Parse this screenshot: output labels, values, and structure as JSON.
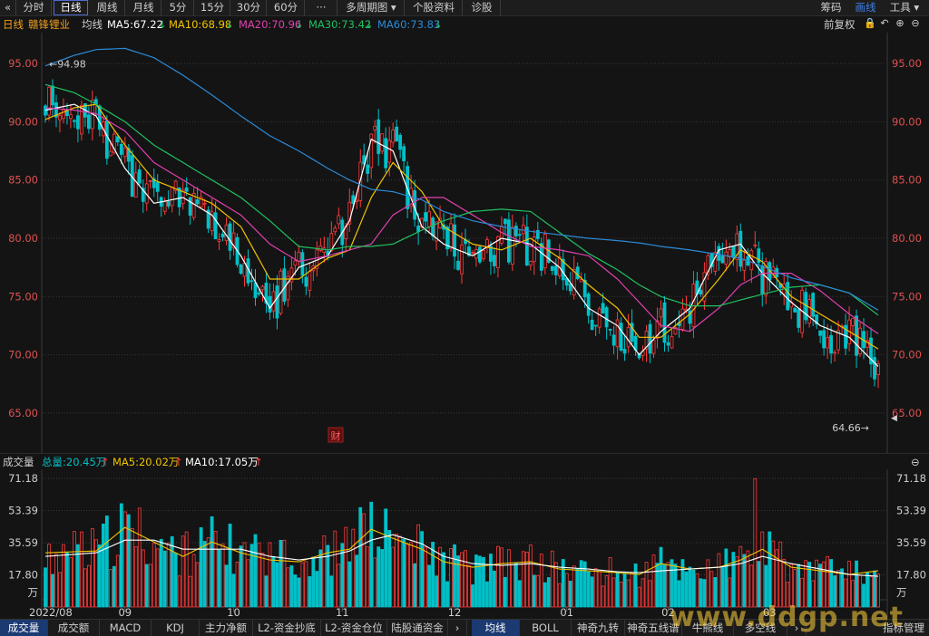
{
  "toolbar": {
    "back": "«",
    "tabs": [
      "分时",
      "日线",
      "周线",
      "月线",
      "5分",
      "15分",
      "30分",
      "60分",
      "···",
      "多周期图 ▾",
      "个股资料",
      "诊股"
    ],
    "active_tab": "日线",
    "right": [
      "筹码",
      "画线",
      "工具 ▾"
    ],
    "right_active": "画线"
  },
  "ma_bar": {
    "period": "日线",
    "stock": "赣锋锂业",
    "avg_label": "均线",
    "ma5": "MA5:67.22",
    "ma10": "MA10:68.98",
    "ma20": "MA20:70.96",
    "ma30": "MA30:73.42",
    "ma60": "MA60:73.83",
    "down_arrow": "↓",
    "fq": "前复权",
    "icons": {
      "lock": "🔒",
      "reset": "↶",
      "zoom_in": "⊕",
      "zoom_out": "⊖"
    }
  },
  "vol_bar": {
    "label": "成交量",
    "total": "总量:20.45万",
    "ma5": "MA5:20.02万",
    "ma10": "MA10:17.05万",
    "up_arrow": "↑",
    "zoom_out": "⊖"
  },
  "colors": {
    "up": "#ff3a3a",
    "down": "#00c0c8",
    "ma5": "#ffffff",
    "ma10": "#f0c400",
    "ma20": "#e040b0",
    "ma30": "#20c060",
    "ma60": "#2a8ad8",
    "axis": "#e05050",
    "grid": "#3a3a3a"
  },
  "chart_data": [
    {
      "type": "candlestick",
      "title": "赣锋锂业 日线",
      "y_ticks": [
        "95.00",
        "90.00",
        "85.00",
        "80.00",
        "75.00",
        "70.00",
        "65.00"
      ],
      "ylim": [
        62.5,
        97.5
      ],
      "x_ticks": [
        "2022/08",
        "09",
        "10",
        "11",
        "12",
        "01",
        "02",
        "03"
      ],
      "annotations": {
        "max_label": "94.98",
        "min_label": "64.66",
        "event_tag": "财"
      },
      "series": [
        {
          "name": "MA5",
          "color": "#ffffff",
          "values": [
            [
              0,
              91.0
            ],
            [
              8,
              91.5
            ],
            [
              14,
              90.5
            ],
            [
              22,
              86
            ],
            [
              30,
              83
            ],
            [
              38,
              83.5
            ],
            [
              46,
              82
            ],
            [
              54,
              78.5
            ],
            [
              62,
              74
            ],
            [
              70,
              77.5
            ],
            [
              78,
              78.5
            ],
            [
              84,
              81.5
            ],
            [
              90,
              88.5
            ],
            [
              96,
              87.5
            ],
            [
              104,
              81
            ],
            [
              110,
              79.5
            ],
            [
              118,
              78.5
            ],
            [
              126,
              80
            ],
            [
              134,
              79.5
            ],
            [
              142,
              77.5
            ],
            [
              150,
              74
            ],
            [
              158,
              72.5
            ],
            [
              164,
              70
            ],
            [
              170,
              72
            ],
            [
              178,
              74
            ],
            [
              186,
              79
            ],
            [
              192,
              79.5
            ],
            [
              198,
              77
            ],
            [
              206,
              74.5
            ],
            [
              214,
              72.5
            ],
            [
              222,
              71.5
            ],
            [
              230,
              69
            ]
          ]
        },
        {
          "name": "MA10",
          "color": "#f0c400",
          "values": [
            [
              0,
              90.2
            ],
            [
              8,
              91.2
            ],
            [
              14,
              91.5
            ],
            [
              22,
              88
            ],
            [
              30,
              85
            ],
            [
              38,
              84
            ],
            [
              46,
              83
            ],
            [
              54,
              81
            ],
            [
              62,
              76.5
            ],
            [
              70,
              76.5
            ],
            [
              78,
              78.3
            ],
            [
              84,
              79
            ],
            [
              90,
              83.5
            ],
            [
              96,
              86.5
            ],
            [
              104,
              84
            ],
            [
              110,
              81
            ],
            [
              118,
              79.5
            ],
            [
              126,
              79
            ],
            [
              134,
              80
            ],
            [
              142,
              78.3
            ],
            [
              150,
              76
            ],
            [
              158,
              74
            ],
            [
              164,
              71.5
            ],
            [
              170,
              71.5
            ],
            [
              178,
              73.5
            ],
            [
              186,
              76.5
            ],
            [
              192,
              79
            ],
            [
              198,
              78
            ],
            [
              206,
              75
            ],
            [
              214,
              73.5
            ],
            [
              222,
              72
            ],
            [
              230,
              70.5
            ]
          ]
        },
        {
          "name": "MA20",
          "color": "#e040b0",
          "values": [
            [
              0,
              91.2
            ],
            [
              8,
              91
            ],
            [
              14,
              90.7
            ],
            [
              22,
              89.2
            ],
            [
              30,
              86.5
            ],
            [
              38,
              85
            ],
            [
              46,
              83.5
            ],
            [
              54,
              82
            ],
            [
              62,
              79.5
            ],
            [
              70,
              78
            ],
            [
              78,
              78.5
            ],
            [
              84,
              79
            ],
            [
              90,
              79.5
            ],
            [
              96,
              82
            ],
            [
              104,
              83.5
            ],
            [
              110,
              83.5
            ],
            [
              118,
              82
            ],
            [
              126,
              80.5
            ],
            [
              134,
              79.3
            ],
            [
              142,
              79
            ],
            [
              150,
              78.5
            ],
            [
              158,
              76.5
            ],
            [
              164,
              74.5
            ],
            [
              170,
              72.5
            ],
            [
              178,
              72
            ],
            [
              186,
              74
            ],
            [
              192,
              76
            ],
            [
              198,
              77
            ],
            [
              206,
              77
            ],
            [
              214,
              75.5
            ],
            [
              222,
              73.5
            ],
            [
              230,
              71.8
            ]
          ]
        },
        {
          "name": "MA30",
          "color": "#20c060",
          "values": [
            [
              0,
              93.2
            ],
            [
              8,
              92.5
            ],
            [
              14,
              91.5
            ],
            [
              22,
              90
            ],
            [
              30,
              88
            ],
            [
              38,
              86.5
            ],
            [
              46,
              85
            ],
            [
              54,
              83.5
            ],
            [
              62,
              81.5
            ],
            [
              70,
              79.3
            ],
            [
              78,
              79
            ],
            [
              84,
              79.3
            ],
            [
              90,
              79.3
            ],
            [
              96,
              79.5
            ],
            [
              104,
              80.7
            ],
            [
              110,
              81.5
            ],
            [
              118,
              82.3
            ],
            [
              126,
              82.5
            ],
            [
              134,
              82.3
            ],
            [
              142,
              80.5
            ],
            [
              150,
              78.7
            ],
            [
              158,
              77.3
            ],
            [
              164,
              76
            ],
            [
              170,
              75
            ],
            [
              178,
              74.2
            ],
            [
              186,
              74.2
            ],
            [
              192,
              74.7
            ],
            [
              198,
              75.2
            ],
            [
              206,
              75.8
            ],
            [
              214,
              76
            ],
            [
              222,
              75.3
            ],
            [
              230,
              73.4
            ]
          ]
        },
        {
          "name": "MA60",
          "color": "#2a8ad8",
          "values": [
            [
              0,
              94.8
            ],
            [
              8,
              95.7
            ],
            [
              14,
              96.2
            ],
            [
              22,
              96.3
            ],
            [
              30,
              95.5
            ],
            [
              38,
              94
            ],
            [
              46,
              92.3
            ],
            [
              54,
              90.5
            ],
            [
              62,
              88.8
            ],
            [
              70,
              87.5
            ],
            [
              78,
              86
            ],
            [
              84,
              85
            ],
            [
              90,
              84.2
            ],
            [
              96,
              84
            ],
            [
              104,
              83.3
            ],
            [
              110,
              82.3
            ],
            [
              118,
              81.5
            ],
            [
              126,
              81
            ],
            [
              134,
              80.6
            ],
            [
              142,
              80.3
            ],
            [
              150,
              80
            ],
            [
              158,
              79.8
            ],
            [
              164,
              79.6
            ],
            [
              170,
              79.3
            ],
            [
              178,
              79
            ],
            [
              186,
              78.6
            ],
            [
              192,
              78.3
            ],
            [
              198,
              77.6
            ],
            [
              206,
              76.6
            ],
            [
              214,
              76
            ],
            [
              222,
              75.3
            ],
            [
              230,
              73.83
            ]
          ]
        }
      ]
    },
    {
      "type": "bar",
      "title": "成交量",
      "y_ticks": [
        "71.18",
        "53.39",
        "35.59",
        "17.80"
      ],
      "unit": "万",
      "ylim": [
        0,
        71.18
      ],
      "x_ticks": [
        "2022/08",
        "09",
        "10",
        "11",
        "12",
        "01",
        "02",
        "03"
      ],
      "series": [
        {
          "name": "MA5",
          "color": "#f0c400",
          "values": [
            [
              0,
              30
            ],
            [
              14,
              31
            ],
            [
              22,
              44
            ],
            [
              30,
              36
            ],
            [
              38,
              28
            ],
            [
              46,
              36
            ],
            [
              54,
              30
            ],
            [
              62,
              26
            ],
            [
              70,
              25
            ],
            [
              78,
              30
            ],
            [
              84,
              32
            ],
            [
              90,
              43
            ],
            [
              96,
              38
            ],
            [
              104,
              32
            ],
            [
              110,
              25
            ],
            [
              118,
              22
            ],
            [
              126,
              24
            ],
            [
              134,
              25
            ],
            [
              142,
              21
            ],
            [
              150,
              20
            ],
            [
              158,
              19
            ],
            [
              164,
              18
            ],
            [
              170,
              24
            ],
            [
              178,
              21
            ],
            [
              186,
              22
            ],
            [
              192,
              26
            ],
            [
              198,
              32
            ],
            [
              206,
              22
            ],
            [
              214,
              20
            ],
            [
              222,
              18
            ],
            [
              230,
              20
            ]
          ]
        },
        {
          "name": "MA10",
          "color": "#ffffff",
          "values": [
            [
              0,
              28
            ],
            [
              14,
              30
            ],
            [
              22,
              37
            ],
            [
              30,
              37
            ],
            [
              38,
              32
            ],
            [
              46,
              32
            ],
            [
              54,
              32
            ],
            [
              62,
              28
            ],
            [
              70,
              26
            ],
            [
              78,
              28
            ],
            [
              84,
              31
            ],
            [
              90,
              37
            ],
            [
              96,
              40
            ],
            [
              104,
              35
            ],
            [
              110,
              28
            ],
            [
              118,
              24
            ],
            [
              126,
              23
            ],
            [
              134,
              24
            ],
            [
              142,
              22
            ],
            [
              150,
              21
            ],
            [
              158,
              19.5
            ],
            [
              164,
              19
            ],
            [
              170,
              20
            ],
            [
              178,
              21
            ],
            [
              186,
              22
            ],
            [
              192,
              24
            ],
            [
              198,
              28
            ],
            [
              206,
              24
            ],
            [
              214,
              21
            ],
            [
              222,
              18
            ],
            [
              230,
              17
            ]
          ]
        }
      ]
    }
  ],
  "bottom_tabs": [
    "成交量",
    "成交额",
    "MACD",
    "KDJ",
    "主力净额",
    "L2-资金抄底",
    "L2-资金仓位",
    "陆股通资金",
    "›",
    "均线",
    "BOLL",
    "神奇九转",
    "神奇五线谱",
    "牛熊线",
    "多空线",
    "›",
    "指标管理"
  ],
  "bottom_active": [
    "成交量",
    "均线"
  ],
  "watermark": "www.ddgp.net"
}
